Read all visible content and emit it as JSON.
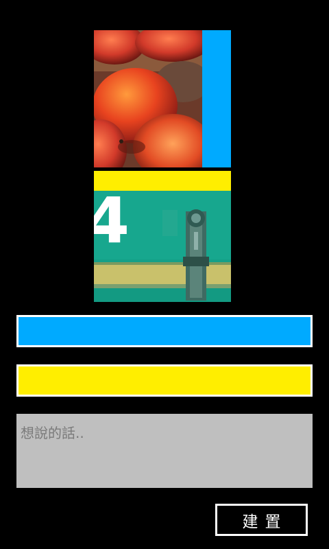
{
  "colors": {
    "accent_blue": "#00aaff",
    "accent_yellow": "#ffee00",
    "background": "#000000",
    "textarea_bg": "#bfbfbf"
  },
  "preview": {
    "top_image": "peaches-photo",
    "bottom_image": "green-metal-number-4-photo",
    "bottom_image_number": "4"
  },
  "message": {
    "placeholder": "想說的話..",
    "value": ""
  },
  "create_button": {
    "label": "建置"
  }
}
